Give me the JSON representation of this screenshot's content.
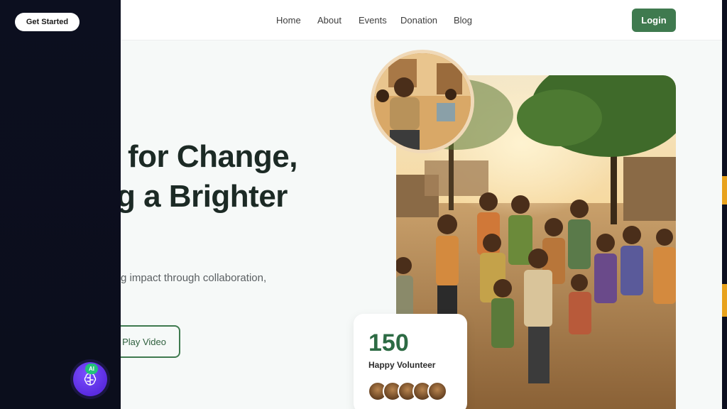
{
  "overlay": {
    "get_started_label": "Get Started",
    "ai_badge": "AI",
    "ai_icon": "brain-icon"
  },
  "nav": {
    "items": [
      "Home",
      "About",
      "Events",
      "Donation",
      "Blog"
    ],
    "login_label": "Login"
  },
  "hero": {
    "line1": "for Change,",
    "line2": "g a Brighter",
    "subtitle": "g impact through collaboration,",
    "play_label": "Play Video"
  },
  "stats": {
    "number": "150",
    "label": "Happy Volunteer",
    "avatar_count": 5
  },
  "colors": {
    "accent": "#3f7a4f",
    "stat_number": "#2d6b44",
    "dark_panel": "#0c0f1f",
    "ai_purple": "#5a2be0",
    "edge_orange": "#e8a21c"
  }
}
